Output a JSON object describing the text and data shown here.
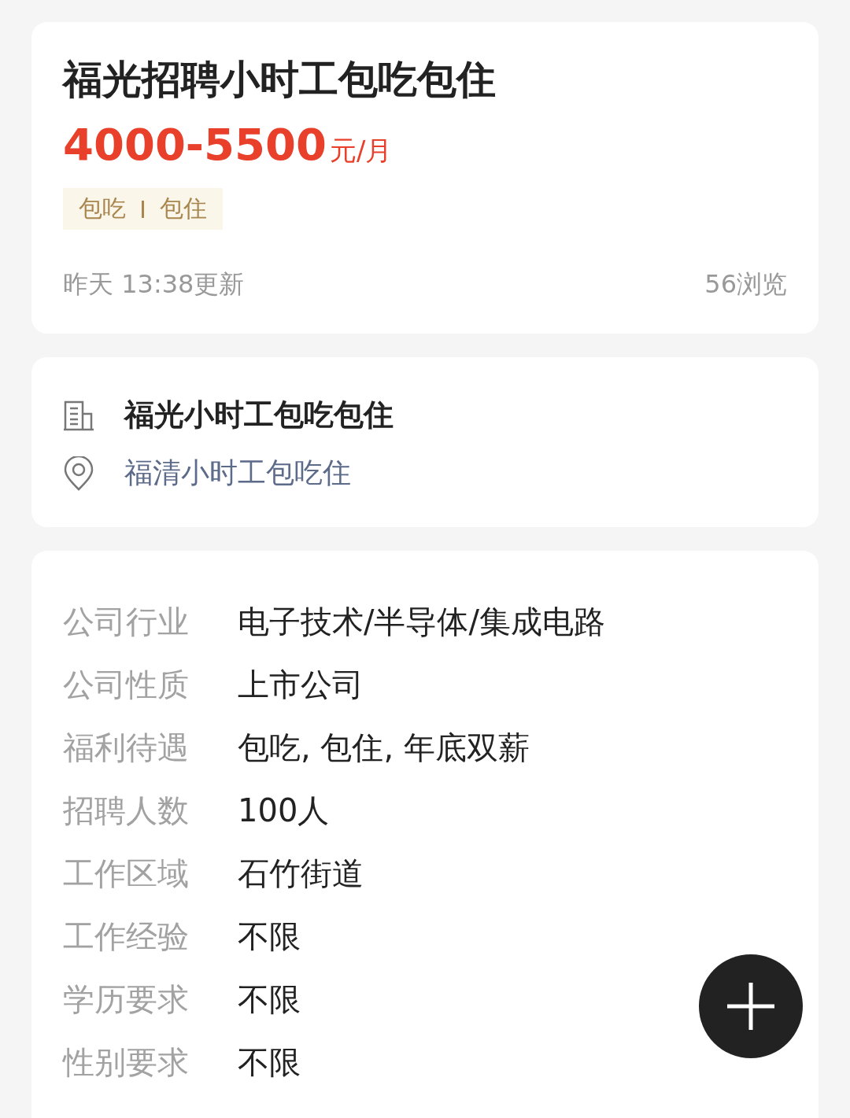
{
  "job": {
    "title": "福光招聘小时工包吃包住",
    "salary": "4000-5500",
    "salary_unit": "元/月",
    "tags": [
      "包吃",
      "包住"
    ],
    "updated": "昨天 13:38更新",
    "views": "56浏览"
  },
  "company": {
    "name": "福光小时工包吃包住",
    "location": "福清小时工包吃住"
  },
  "details": [
    {
      "label": "公司行业",
      "value": "电子技术/半导体/集成电路"
    },
    {
      "label": "公司性质",
      "value": "上市公司"
    },
    {
      "label": "福利待遇",
      "value": "包吃, 包住, 年底双薪"
    },
    {
      "label": "招聘人数",
      "value": "100人"
    },
    {
      "label": "工作区域",
      "value": "石竹街道"
    },
    {
      "label": "工作经验",
      "value": "不限"
    },
    {
      "label": "学历要求",
      "value": "不限"
    },
    {
      "label": "性别要求",
      "value": "不限"
    }
  ],
  "fab": {
    "kind": "add"
  }
}
